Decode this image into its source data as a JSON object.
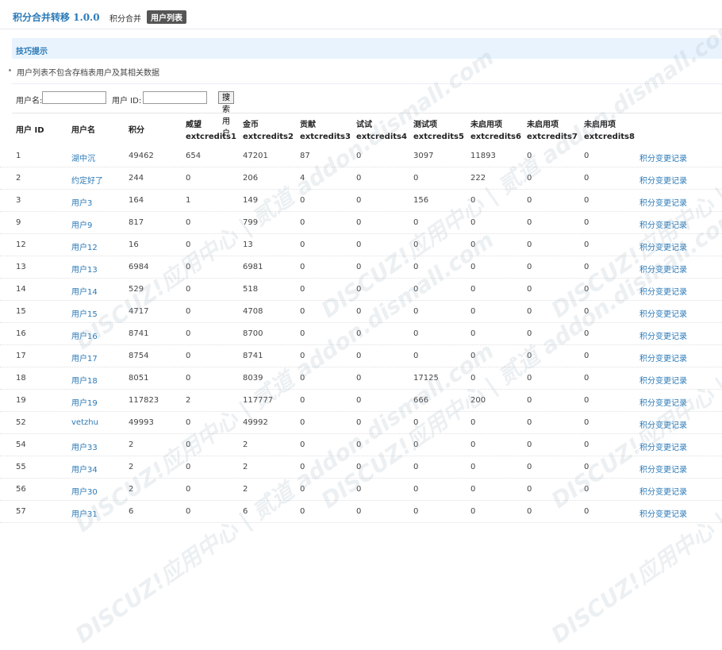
{
  "header": {
    "title": "积分合并转移 1.0.0",
    "tabs": [
      "积分合并",
      "用户列表"
    ]
  },
  "tips": {
    "title": "技巧提示",
    "items": [
      "用户列表不包含存档表用户及其相关数据"
    ]
  },
  "search": {
    "username_label": "用户名:",
    "uid_label": "用户 ID:",
    "username_value": "",
    "uid_value": "",
    "button_label": "搜索用户"
  },
  "table": {
    "columns": [
      {
        "title": "用户 ID",
        "sub": ""
      },
      {
        "title": "用户名",
        "sub": ""
      },
      {
        "title": "积分",
        "sub": ""
      },
      {
        "title": "威望",
        "sub": "extcredits1"
      },
      {
        "title": "金币",
        "sub": "extcredits2"
      },
      {
        "title": "贡献",
        "sub": "extcredits3"
      },
      {
        "title": "试试",
        "sub": "extcredits4"
      },
      {
        "title": "测试项",
        "sub": "extcredits5"
      },
      {
        "title": "未启用项",
        "sub": "extcredits6"
      },
      {
        "title": "未启用项",
        "sub": "extcredits7"
      },
      {
        "title": "未启用项",
        "sub": "extcredits8"
      }
    ],
    "action_label": "积分变更记录",
    "rows": [
      [
        "1",
        "湖中沉",
        "49462",
        "654",
        "47201",
        "87",
        "0",
        "3097",
        "11893",
        "0",
        "0"
      ],
      [
        "2",
        "约定好了",
        "244",
        "0",
        "206",
        "4",
        "0",
        "0",
        "222",
        "0",
        "0"
      ],
      [
        "3",
        "用户3",
        "164",
        "1",
        "149",
        "0",
        "0",
        "156",
        "0",
        "0",
        "0"
      ],
      [
        "9",
        "用户9",
        "817",
        "0",
        "799",
        "0",
        "0",
        "0",
        "0",
        "0",
        "0"
      ],
      [
        "12",
        "用户12",
        "16",
        "0",
        "13",
        "0",
        "0",
        "0",
        "0",
        "0",
        "0"
      ],
      [
        "13",
        "用户13",
        "6984",
        "0",
        "6981",
        "0",
        "0",
        "0",
        "0",
        "0",
        "0"
      ],
      [
        "14",
        "用户14",
        "529",
        "0",
        "518",
        "0",
        "0",
        "0",
        "0",
        "0",
        "0"
      ],
      [
        "15",
        "用户15",
        "4717",
        "0",
        "4708",
        "0",
        "0",
        "0",
        "0",
        "0",
        "0"
      ],
      [
        "16",
        "用户16",
        "8741",
        "0",
        "8700",
        "0",
        "0",
        "0",
        "0",
        "0",
        "0"
      ],
      [
        "17",
        "用户17",
        "8754",
        "0",
        "8741",
        "0",
        "0",
        "0",
        "0",
        "0",
        "0"
      ],
      [
        "18",
        "用户18",
        "8051",
        "0",
        "8039",
        "0",
        "0",
        "17125",
        "0",
        "0",
        "0"
      ],
      [
        "19",
        "用户19",
        "117823",
        "2",
        "117777",
        "0",
        "0",
        "666",
        "200",
        "0",
        "0"
      ],
      [
        "52",
        "vetzhu",
        "49993",
        "0",
        "49992",
        "0",
        "0",
        "0",
        "0",
        "0",
        "0"
      ],
      [
        "54",
        "用户33",
        "2",
        "0",
        "2",
        "0",
        "0",
        "0",
        "0",
        "0",
        "0"
      ],
      [
        "55",
        "用户34",
        "2",
        "0",
        "2",
        "0",
        "0",
        "0",
        "0",
        "0",
        "0"
      ],
      [
        "56",
        "用户30",
        "2",
        "0",
        "2",
        "0",
        "0",
        "0",
        "0",
        "0",
        "0"
      ],
      [
        "57",
        "用户31",
        "6",
        "0",
        "6",
        "0",
        "0",
        "0",
        "0",
        "0",
        "0"
      ]
    ]
  },
  "watermark": "DISCUZ!应用中心 | 贰道 addon.dismall.com"
}
